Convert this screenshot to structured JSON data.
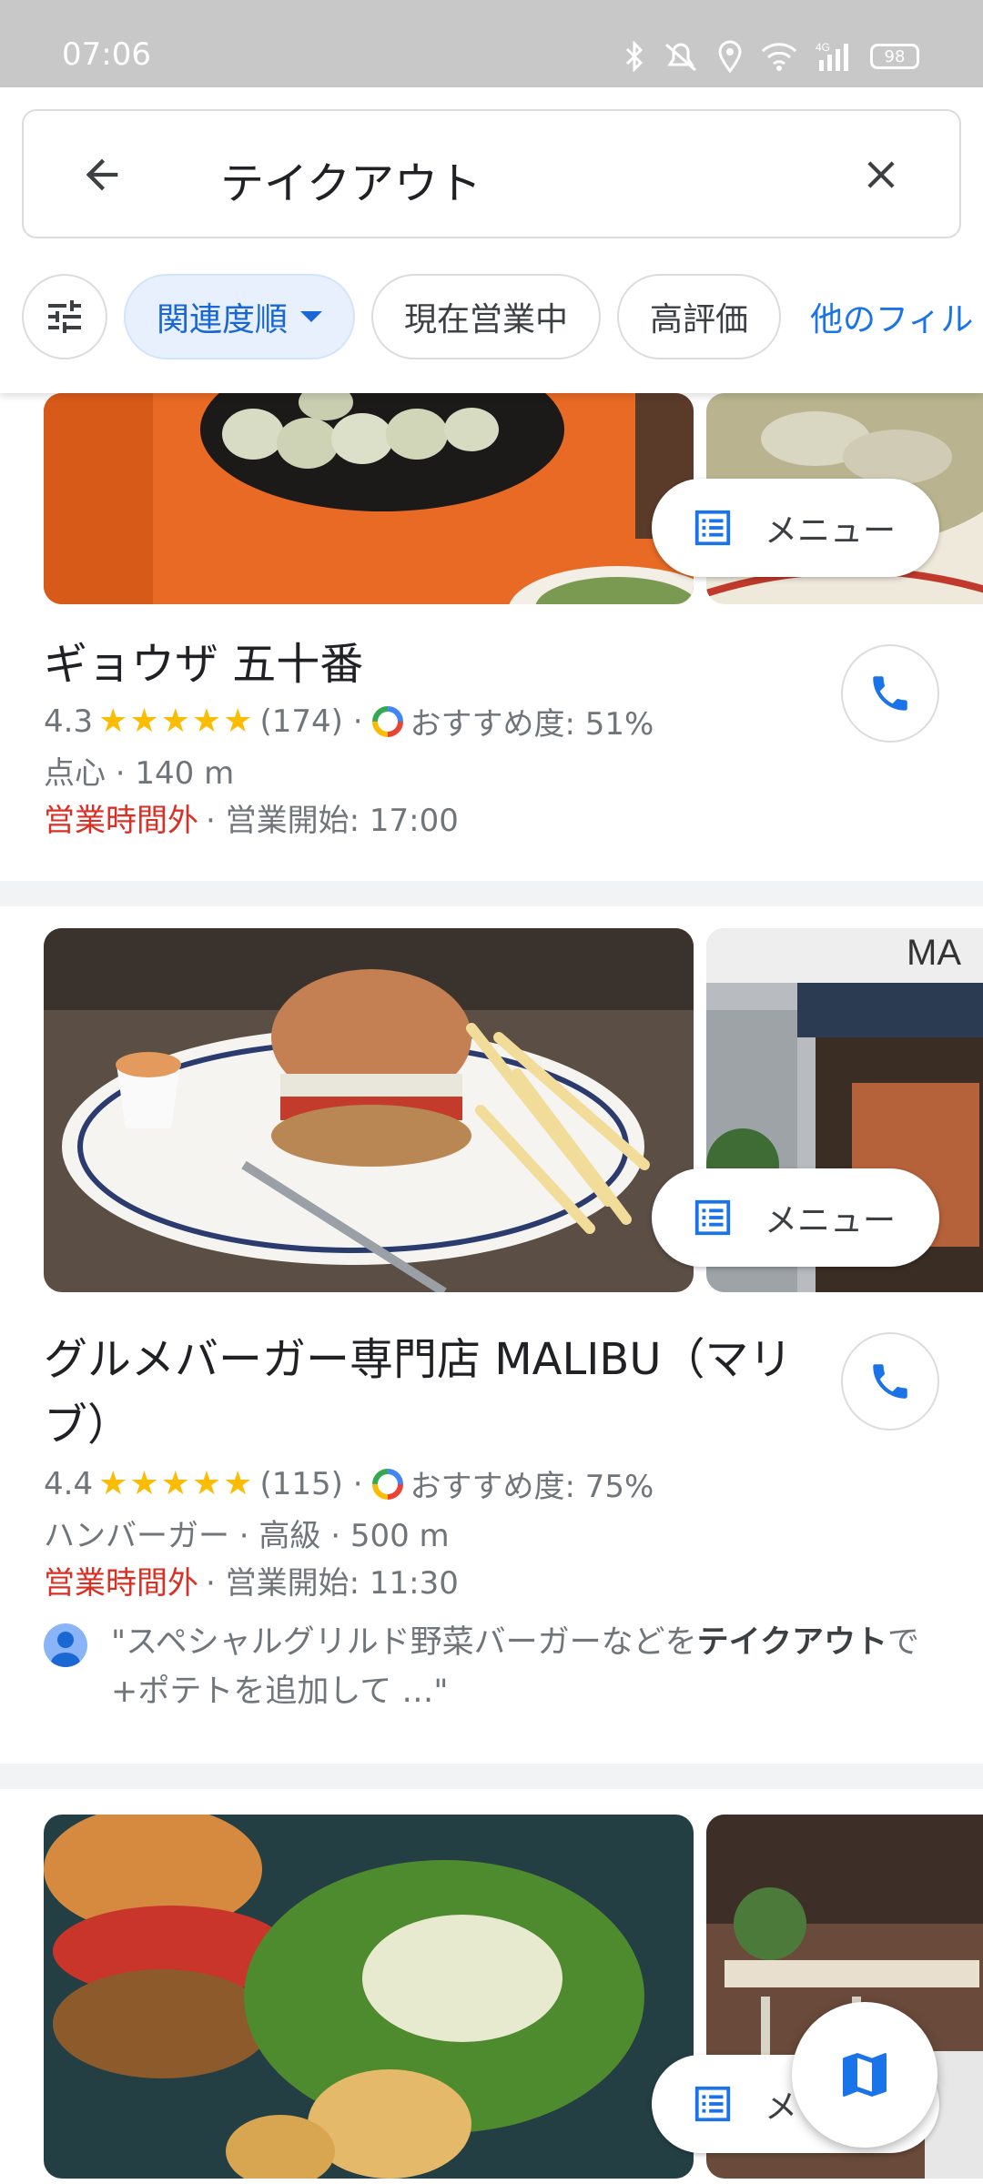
{
  "status_bar": {
    "time": "07:06",
    "battery": "98"
  },
  "search": {
    "query": "テイクアウト"
  },
  "filters": {
    "sort": "関連度順",
    "open_now": "現在営業中",
    "top_rated": "高評価",
    "more": "他のフィル"
  },
  "results": [
    {
      "name": "ギョウザ 五十番",
      "rating": "4.3",
      "stars": "★★★★★",
      "reviews": "(174)",
      "recommend": "おすすめ度: 51%",
      "category_distance": "点心 · 140 m",
      "status": "営業時間外",
      "opens": "· 営業開始: 17:00",
      "menu_label": "メニュー"
    },
    {
      "name": "グルメバーガー専門店 MALIBU（マリブ）",
      "rating": "4.4",
      "stars": "★★★★★",
      "reviews": "(115)",
      "recommend": "おすすめ度: 75%",
      "category_distance": "ハンバーガー · 高級 · 500 m",
      "status": "営業時間外",
      "opens": "· 営業開始: 11:30",
      "menu_label": "メニュー",
      "review_pre": "\"スペシャルグリルド野菜バーガーなどを",
      "review_bold": "テイクアウト",
      "review_post": "で+ポテトを追加して …\""
    },
    {
      "menu_label": "メ"
    }
  ],
  "colors": {
    "accent": "#1a73e8",
    "closed": "#d93025",
    "star": "#fbbc04"
  }
}
